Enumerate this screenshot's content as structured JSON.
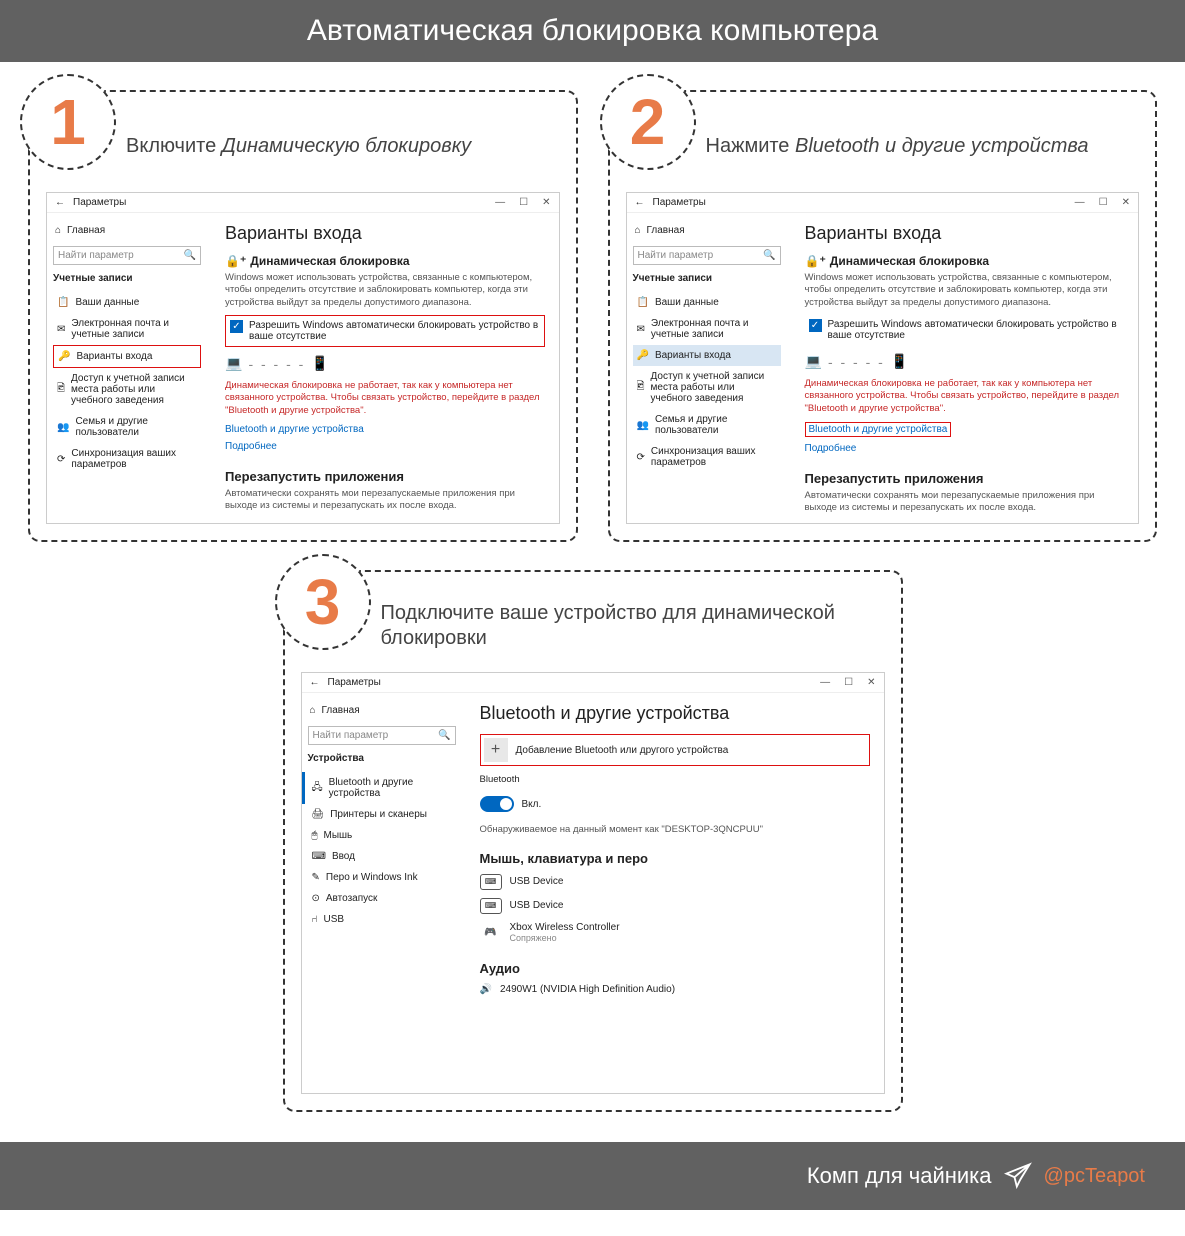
{
  "header": "Автоматическая блокировка компьютера",
  "steps": {
    "s1": {
      "num": "1",
      "title_a": "Включите ",
      "title_b": "Динамическую блокировку"
    },
    "s2": {
      "num": "2",
      "title_a": "Нажмите ",
      "title_b": "Bluetooth и другие устройства"
    },
    "s3": {
      "num": "3",
      "title_a": "Подключите ваше устройство для динамической блокировки",
      "title_b": ""
    }
  },
  "win": {
    "title": "Параметры",
    "home": "Главная",
    "search_ph": "Найти параметр",
    "acct_label": "Учетные записи",
    "dev_label": "Устройства",
    "nav_acct": [
      "Ваши данные",
      "Электронная почта и учетные записи",
      "Варианты входа",
      "Доступ к учетной записи места работы или учебного заведения",
      "Семья и другие пользователи",
      "Синхронизация ваших параметров"
    ],
    "nav_dev": [
      "Bluetooth и другие устройства",
      "Принтеры и сканеры",
      "Мышь",
      "Ввод",
      "Перо и Windows Ink",
      "Автозапуск",
      "USB"
    ],
    "signin_h1": "Варианты входа",
    "dyn_h2": "Динамическая блокировка",
    "dyn_desc": "Windows может использовать устройства, связанные с компьютером, чтобы определить отсутствие и заблокировать компьютер, когда эти устройства выйдут за пределы допустимого диапазона.",
    "cb_label": "Разрешить Windows автоматически блокировать устройство в ваше отсутствие",
    "red_warn": "Динамическая блокировка не работает, так как у компьютера нет связанного устройства. Чтобы связать устройство, перейдите в раздел \"Bluetooth и другие устройства\".",
    "link_bt": "Bluetooth и другие устройства",
    "link_more": "Подробнее",
    "restart_h3": "Перезапустить приложения",
    "restart_desc": "Автоматически сохранять мои перезапускаемые приложения при выходе из системы и перезапускать их после входа.",
    "bt_h1": "Bluetooth и другие устройства",
    "add_bt": "Добавление Bluetooth или другого устройства",
    "bt_label": "Bluetooth",
    "bt_on": "Вкл.",
    "discover": "Обнаруживаемое на данный момент как \"DESKTOP-3QNCPUU\"",
    "mkp_h3": "Мышь, клавиатура и перо",
    "usb_dev": "USB Device",
    "xbox": "Xbox Wireless Controller",
    "xbox_sub": "Сопряжено",
    "audio_h3": "Аудио",
    "audio_dev": "2490W1 (NVIDIA High Definition Audio)"
  },
  "footer": {
    "text": "Комп для чайника",
    "handle": "@pcTeapot"
  }
}
